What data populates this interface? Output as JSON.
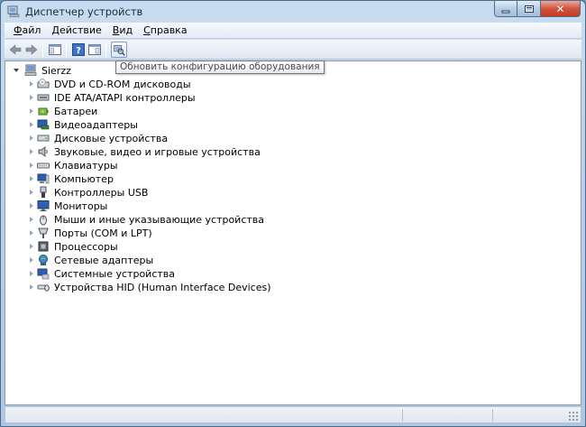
{
  "window": {
    "title": "Диспетчер устройств"
  },
  "menu": [
    {
      "pre": "",
      "key": "Ф",
      "post": "айл"
    },
    {
      "pre": "",
      "key": "Д",
      "post": "ействие"
    },
    {
      "pre": "",
      "key": "В",
      "post": "ид"
    },
    {
      "pre": "",
      "key": "С",
      "post": "правка"
    }
  ],
  "tooltip": "Обновить конфигурацию оборудования",
  "tree": {
    "root": {
      "label": "Sierzz",
      "icon": "computer-icon"
    },
    "items": [
      {
        "label": "DVD и CD-ROM дисководы",
        "icon": "dvd-drive-icon"
      },
      {
        "label": "IDE ATA/ATAPI контроллеры",
        "icon": "ide-controller-icon"
      },
      {
        "label": "Батареи",
        "icon": "battery-icon"
      },
      {
        "label": "Видеоадаптеры",
        "icon": "display-adapter-icon"
      },
      {
        "label": "Дисковые устройства",
        "icon": "disk-drive-icon"
      },
      {
        "label": "Звуковые, видео и игровые устройства",
        "icon": "speaker-icon"
      },
      {
        "label": "Клавиатуры",
        "icon": "keyboard-icon"
      },
      {
        "label": "Компьютер",
        "icon": "computer-icon"
      },
      {
        "label": "Контроллеры USB",
        "icon": "usb-icon"
      },
      {
        "label": "Мониторы",
        "icon": "monitor-icon"
      },
      {
        "label": "Мыши и иные указывающие устройства",
        "icon": "mouse-icon"
      },
      {
        "label": "Порты (COM и LPT)",
        "icon": "port-icon"
      },
      {
        "label": "Процессоры",
        "icon": "processor-icon"
      },
      {
        "label": "Сетевые адаптеры",
        "icon": "network-adapter-icon"
      },
      {
        "label": "Системные устройства",
        "icon": "system-device-icon"
      },
      {
        "label": "Устройства HID (Human Interface Devices)",
        "icon": "hid-icon"
      }
    ]
  }
}
